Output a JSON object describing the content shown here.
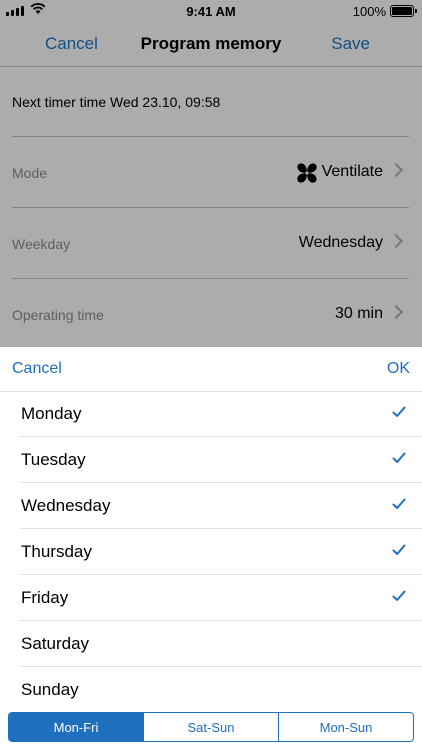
{
  "status_bar": {
    "time": "9:41 AM",
    "battery": "100%"
  },
  "nav": {
    "cancel": "Cancel",
    "title": "Program memory",
    "save": "Save"
  },
  "form": {
    "next_timer": "Next timer time Wed 23.10, 09:58",
    "rows": [
      {
        "label": "Mode",
        "value": "Ventilate",
        "icon": "fan-icon"
      },
      {
        "label": "Weekday",
        "value": "Wednesday"
      },
      {
        "label": "Operating time",
        "value": "30 min"
      }
    ]
  },
  "sheet": {
    "cancel": "Cancel",
    "ok": "OK",
    "days": [
      {
        "label": "Monday",
        "checked": true
      },
      {
        "label": "Tuesday",
        "checked": true
      },
      {
        "label": "Wednesday",
        "checked": true
      },
      {
        "label": "Thursday",
        "checked": true
      },
      {
        "label": "Friday",
        "checked": true
      },
      {
        "label": "Saturday",
        "checked": false
      },
      {
        "label": "Sunday",
        "checked": false
      }
    ],
    "segments": [
      {
        "label": "Mon-Fri",
        "selected": true
      },
      {
        "label": "Sat-Sun",
        "selected": false
      },
      {
        "label": "Mon-Sun",
        "selected": false
      }
    ]
  },
  "colors": {
    "accent": "#1f6fbf",
    "overlay": "rgba(0,0,0,0.30)"
  }
}
